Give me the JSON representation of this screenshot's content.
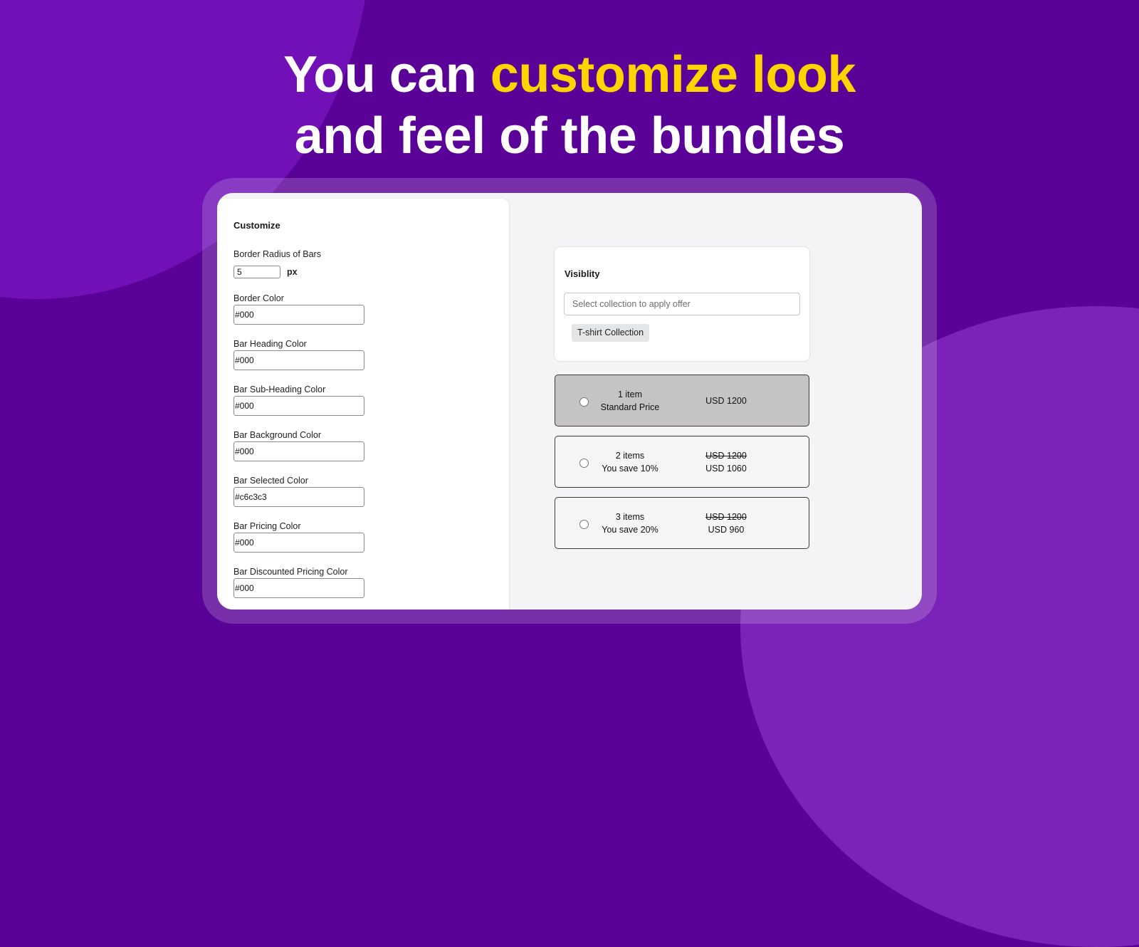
{
  "headline": {
    "line1_prefix": "You can ",
    "line1_accent": "customize look",
    "line2": "and feel of the bundles",
    "accent_color": "#ffd400"
  },
  "customize": {
    "title": "Customize",
    "border_radius": {
      "label": "Border Radius of Bars",
      "value": "5",
      "unit": "px"
    },
    "fields": [
      {
        "label": "Border Color",
        "value": "#000"
      },
      {
        "label": "Bar Heading Color",
        "value": "#000"
      },
      {
        "label": "Bar Sub-Heading Color",
        "value": "#000"
      },
      {
        "label": "Bar Background Color",
        "value": "#000"
      },
      {
        "label": "Bar Selected Color",
        "value": "#c6c3c3"
      },
      {
        "label": "Bar Pricing Color",
        "value": "#000"
      },
      {
        "label": "Bar Discounted Pricing Color",
        "value": "#000"
      }
    ]
  },
  "visibility": {
    "title": "Visiblity",
    "select_placeholder": "Select collection to apply offer",
    "tags": [
      "T-shirt Collection"
    ]
  },
  "bars": [
    {
      "heading": "1 item",
      "subheading": "Standard Price",
      "price": "USD 1200",
      "original_price": "",
      "selected": true
    },
    {
      "heading": "2 items",
      "subheading": "You save 10%",
      "price": "USD 1060",
      "original_price": "USD 1200",
      "selected": false
    },
    {
      "heading": "3 items",
      "subheading": "You save 20%",
      "price": "USD 960",
      "original_price": "USD 1200",
      "selected": false
    }
  ],
  "colors": {
    "background": "#5a0298",
    "selected_bar": "#c6c3c3"
  }
}
